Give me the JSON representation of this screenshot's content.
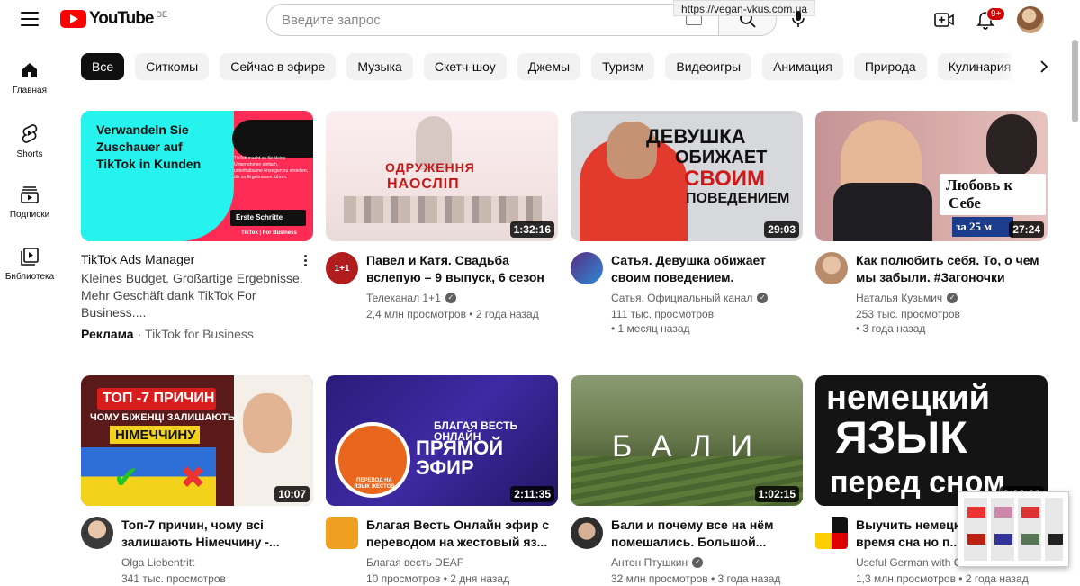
{
  "header": {
    "logo_text": "YouTube",
    "logo_region": "DE",
    "search_placeholder": "Введите запрос",
    "url_tooltip": "https://vegan-vkus.com.ua",
    "notifications_badge": "9+"
  },
  "sidebar": {
    "items": [
      {
        "label": "Главная",
        "icon": "home-icon"
      },
      {
        "label": "Shorts",
        "icon": "shorts-icon"
      },
      {
        "label": "Подписки",
        "icon": "subscriptions-icon"
      },
      {
        "label": "Библиотека",
        "icon": "library-icon"
      }
    ]
  },
  "chips": [
    "Все",
    "Ситкомы",
    "Сейчас в эфире",
    "Музыка",
    "Скетч-шоу",
    "Джемы",
    "Туризм",
    "Видеоигры",
    "Анимация",
    "Природа",
    "Кулинария"
  ],
  "ad": {
    "thumb_text": "Verwandeln Sie Zuschauer auf TikTok in Kunden",
    "thumb_small": "TikTok macht es für kleine Unternehmen einfach, unterhaltsame Anzeigen zu erstellen, die zu Ergebnissen führen.",
    "thumb_button": "Erste Schritte",
    "thumb_brand": "TikTok | For Business",
    "title": "TikTok Ads Manager",
    "desc_line1": "Kleines Budget. Großartige Ergebnisse.",
    "desc_line2": "Mehr Geschäft dank TikTok For Business....",
    "ad_label": "Реклама",
    "advertiser": "· TikTok for Business"
  },
  "videos": [
    {
      "title": "Павел и Катя. Свадьба вслепую – 9 выпуск, 6 сезон",
      "channel": "Телеканал 1+1",
      "stats1": "2,4 млн просмотров • 2 года назад",
      "stats2": "",
      "duration": "1:32:16",
      "thumb_text": [
        "ОДРУЖЕННЯ",
        "НАОСЛІП"
      ],
      "avatar_text": "1+1"
    },
    {
      "title": "Сатья. Девушка обижает своим поведением.",
      "channel": "Сатья. Официальный канал",
      "stats1": "111 тыс. просмотров",
      "stats2": "• 1 месяц назад",
      "duration": "29:03",
      "thumb_text": [
        "ДЕВУШКА",
        "ОБИЖАЕТ",
        "СВОИМ",
        "ПОВЕДЕНИЕМ"
      ]
    },
    {
      "title": "Как полюбить себя. То, о чем мы забыли. #Загоночки",
      "channel": "Наталья Кузьмич",
      "stats1": "253 тыс. просмотров",
      "stats2": "• 3 года назад",
      "duration": "27:24",
      "thumb_text": [
        "Любовь к",
        "Себе",
        "за 25 м"
      ]
    },
    {
      "title": "Топ-7 причин, чому всі залишають Німеччину -...",
      "channel": "Olga Liebentritt",
      "stats1": "341 тыс. просмотров",
      "stats2": "",
      "duration": "10:07",
      "verified": false,
      "thumb_text": [
        "ТОП -7 ПРИЧИН",
        "ЧОМУ БІЖЕНЦІ ЗАЛИШАЮТЬ",
        "НІМЕЧЧИНУ"
      ]
    },
    {
      "title": "Благая Весть Онлайн эфир с переводом на жестовый яз...",
      "channel": "Благая весть DEAF",
      "stats1": "10 просмотров • 2 дня назад",
      "stats2": "",
      "duration": "2:11:35",
      "verified": false,
      "thumb_text": [
        "БЛАГАЯ ВЕСТЬ ОНЛАЙН",
        "ПРЯМОЙ ЭФИР",
        "ПЕРЕВОД НА ЯЗЫК ЖЕСТОВ"
      ]
    },
    {
      "title": "Бали и почему все на нём помешались. Большой...",
      "channel": "Антон Птушкин",
      "stats1": "32 млн просмотров • 3 года назад",
      "stats2": "",
      "duration": "1:02:15",
      "thumb_text": [
        "Б А Л И"
      ]
    },
    {
      "title": "Выучить немецкий язык во время сна но п...",
      "channel": "Useful German with Cl...",
      "stats1": "1,3 млн просмотров • 2 года назад",
      "stats2": "",
      "duration": "8:00:00",
      "verified": false,
      "thumb_text": [
        "немецкий",
        "ЯЗЫК",
        "перед сном"
      ]
    }
  ]
}
